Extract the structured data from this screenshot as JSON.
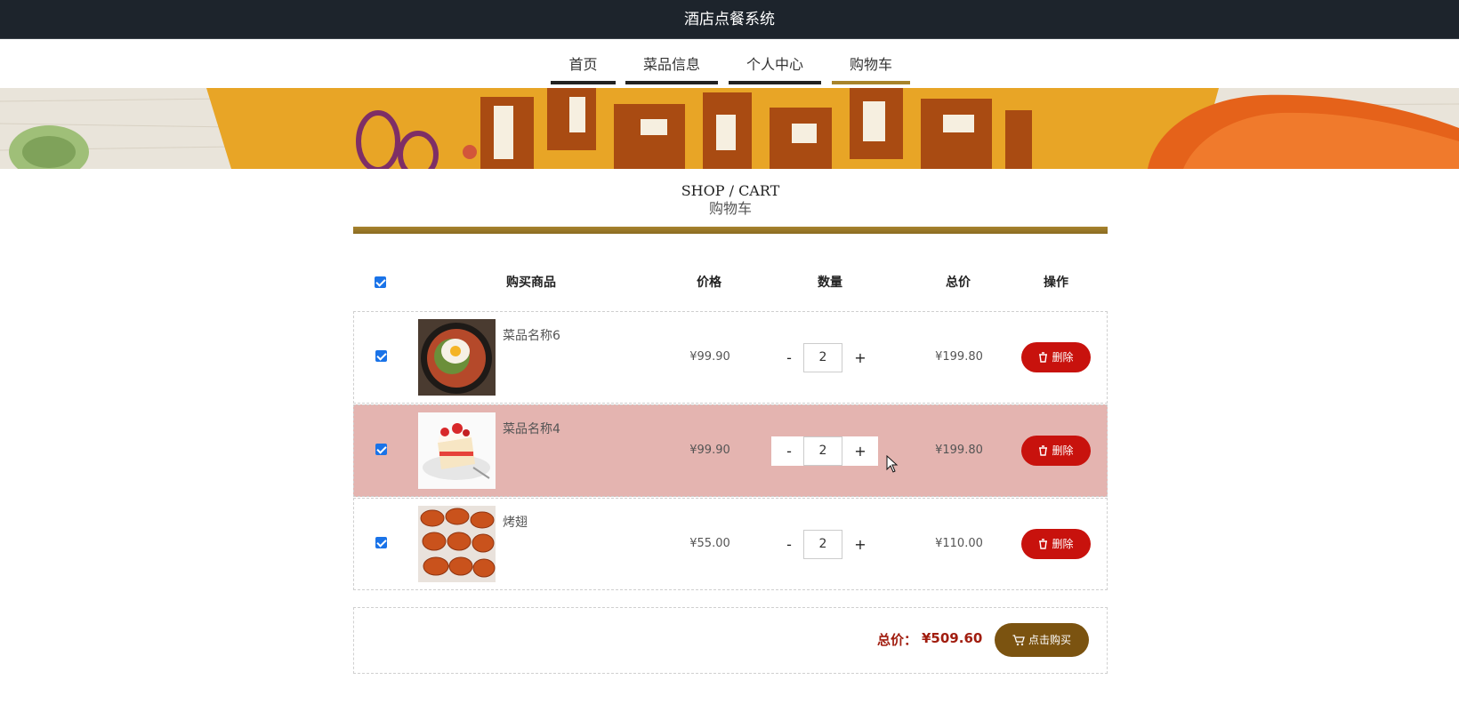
{
  "header": {
    "title": "酒店点餐系统"
  },
  "nav": [
    {
      "label": "首页",
      "active": false
    },
    {
      "label": "菜品信息",
      "active": false
    },
    {
      "label": "个人中心",
      "active": false
    },
    {
      "label": "购物车",
      "active": true
    }
  ],
  "section": {
    "title_en": "SHOP / CART",
    "title_cn": "购物车"
  },
  "table": {
    "headers": {
      "product": "购买商品",
      "price": "价格",
      "quantity": "数量",
      "total": "总价",
      "action": "操作"
    },
    "select_all_checked": true,
    "rows": [
      {
        "name": "菜品名称6",
        "price": "¥99.90",
        "qty_minus": "-",
        "qty": "2",
        "qty_plus": "+",
        "total": "¥199.80",
        "delete_label": "删除",
        "checked": true,
        "image": "bibimbap-dish"
      },
      {
        "name": "菜品名称4",
        "price": "¥99.90",
        "qty_minus": "-",
        "qty": "2",
        "qty_plus": "+",
        "total": "¥199.80",
        "delete_label": "删除",
        "checked": true,
        "image": "strawberry-cake"
      },
      {
        "name": "烤翅",
        "price": "¥55.00",
        "qty_minus": "-",
        "qty": "2",
        "qty_plus": "+",
        "total": "¥110.00",
        "delete_label": "删除",
        "checked": true,
        "image": "roasted-wings"
      }
    ]
  },
  "summary": {
    "total_label": "总价：",
    "total_value": "¥509.60",
    "buy_label": "点击购买"
  },
  "colors": {
    "header_bg": "#1d242c",
    "gold": "#a8842c",
    "delete_red": "#c8120d",
    "buy_brown": "#7b5310",
    "total_red": "#a11d0f",
    "hover_row": "#e4b4b0"
  },
  "icons": {
    "delete": "trash-icon",
    "buy": "cart-icon"
  }
}
